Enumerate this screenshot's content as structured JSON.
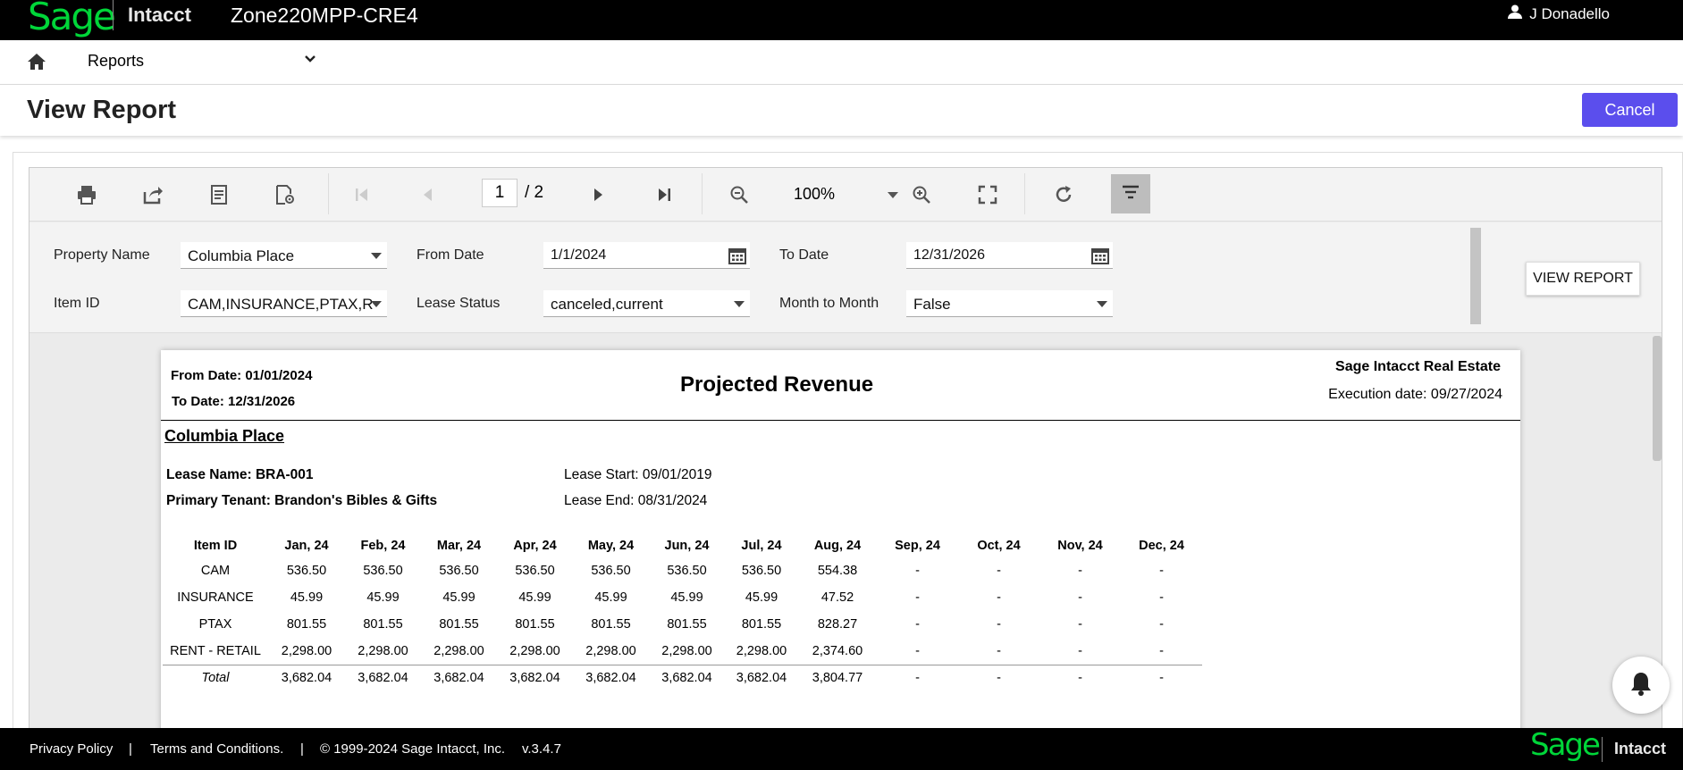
{
  "header": {
    "logo_text": "Sage",
    "product": "Intacct",
    "company": "Zone220MPP-CRE4",
    "user": "J Donadello"
  },
  "nav": {
    "module": "Reports"
  },
  "page": {
    "title": "View Report",
    "cancel_label": "Cancel"
  },
  "toolbar": {
    "page_current": "1",
    "page_total": "/ 2",
    "zoom": "100%"
  },
  "params": {
    "property_name_label": "Property Name",
    "property_name_value": "Columbia Place",
    "from_date_label": "From Date",
    "from_date_value": "1/1/2024",
    "to_date_label": "To Date",
    "to_date_value": "12/31/2026",
    "item_id_label": "Item ID",
    "item_id_value": "CAM,INSURANCE,PTAX,R",
    "lease_status_label": "Lease Status",
    "lease_status_value": "canceled,current",
    "month_to_month_label": "Month to Month",
    "month_to_month_value": "False",
    "view_report_label": "VIEW REPORT"
  },
  "report": {
    "from_date": "From Date: 01/01/2024",
    "to_date": "To Date: 12/31/2026",
    "title": "Projected Revenue",
    "company": "Sage Intacct Real Estate",
    "execution_date": "Execution date: 09/27/2024",
    "property": "Columbia Place",
    "lease_name": "Lease Name: BRA-001",
    "primary_tenant": "Primary Tenant: Brandon's Bibles & Gifts",
    "lease_start": "Lease Start: 09/01/2019",
    "lease_end": "Lease End: 08/31/2024",
    "columns": [
      "Item ID",
      "Jan, 24",
      "Feb, 24",
      "Mar, 24",
      "Apr, 24",
      "May, 24",
      "Jun, 24",
      "Jul, 24",
      "Aug, 24",
      "Sep, 24",
      "Oct, 24",
      "Nov, 24",
      "Dec, 24"
    ],
    "rows": [
      [
        "CAM",
        "536.50",
        "536.50",
        "536.50",
        "536.50",
        "536.50",
        "536.50",
        "536.50",
        "554.38",
        "-",
        "-",
        "-",
        "-"
      ],
      [
        "INSURANCE",
        "45.99",
        "45.99",
        "45.99",
        "45.99",
        "45.99",
        "45.99",
        "45.99",
        "47.52",
        "-",
        "-",
        "-",
        "-"
      ],
      [
        "PTAX",
        "801.55",
        "801.55",
        "801.55",
        "801.55",
        "801.55",
        "801.55",
        "801.55",
        "828.27",
        "-",
        "-",
        "-",
        "-"
      ],
      [
        "RENT - RETAIL",
        "2,298.00",
        "2,298.00",
        "2,298.00",
        "2,298.00",
        "2,298.00",
        "2,298.00",
        "2,298.00",
        "2,374.60",
        "-",
        "-",
        "-",
        "-"
      ]
    ],
    "total_row": [
      "Total",
      "3,682.04",
      "3,682.04",
      "3,682.04",
      "3,682.04",
      "3,682.04",
      "3,682.04",
      "3,682.04",
      "3,804.77",
      "-",
      "-",
      "-",
      "-"
    ]
  },
  "footer": {
    "privacy": "Privacy Policy",
    "sep1": "|",
    "terms": "Terms and Conditions.",
    "sep2": "|",
    "copyright": "© 1999-2024 Sage Intacct, Inc.",
    "version": "v.3.4.7",
    "logo_text": "Sage",
    "product": "Intacct"
  }
}
